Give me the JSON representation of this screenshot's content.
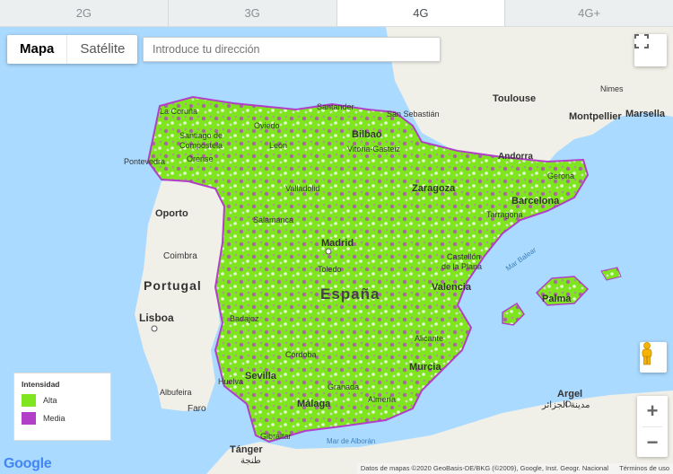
{
  "tabs": [
    {
      "label": "2G"
    },
    {
      "label": "3G"
    },
    {
      "label": "4G"
    },
    {
      "label": "4G+"
    }
  ],
  "active_tab": "4G",
  "map_type": {
    "map_label": "Mapa",
    "satellite_label": "Satélite",
    "selected": "Mapa"
  },
  "search": {
    "placeholder": "Introduce tu dirección",
    "value": ""
  },
  "legend": {
    "title": "Intensidad",
    "items": [
      {
        "label": "Alta",
        "color": "#7fe51f"
      },
      {
        "label": "Media",
        "color": "#b23fc8"
      }
    ]
  },
  "colors": {
    "sea": "#aadaff",
    "land": "#f1f0e8",
    "coverage_high": "#7fe51f",
    "coverage_medium": "#b23fc8"
  },
  "places": {
    "spain": "España",
    "portugal": "Portugal",
    "lisboa": "Lisboa",
    "oporto": "Oporto",
    "coimbra": "Coimbra",
    "faro": "Faro",
    "albufeira": "Albufeira",
    "madrid": "Madrid",
    "toledo": "Toledo",
    "valencia": "Valencia",
    "barcelona": "Barcelona",
    "tarragona": "Tarragona",
    "zaragoza": "Zaragoza",
    "bilbao": "Bilbao",
    "santander": "Santander",
    "san_sebastian": "San Sebastián",
    "vitoria": "Vitoria-Gasteiz",
    "oviedo": "Oviedo",
    "la_coruna": "La Coruña",
    "santiago": "Santiago de Compostela",
    "pontevedra": "Pontevedra",
    "orense": "Orense",
    "leon": "León",
    "valladolid": "Valladolid",
    "salamanca": "Salamanca",
    "badajoz": "Badajoz",
    "cordoba": "Córdoba",
    "sevilla": "Sevilla",
    "huelva": "Huelva",
    "granada": "Granada",
    "malaga": "Málaga",
    "almeria": "Almería",
    "murcia": "Murcia",
    "alicante": "Alicante",
    "castellon": "Castellón de la Plana",
    "palma": "Palma",
    "gibraltar": "Gibraltar",
    "tanger": "Tánger",
    "tanger_ar": "طنجة",
    "argel": "Argel",
    "argel_ar": "مدينة الجزائر",
    "andorra": "Andorra",
    "girona": "Gerona",
    "toulouse": "Toulouse",
    "nimes": "Nimes",
    "montpellier": "Montpellier",
    "marsella": "Marsella",
    "mar_balear": "Mar Balear",
    "mar_alboran": "Mar de Alborán"
  },
  "branding": {
    "logo": "Google"
  },
  "attribution": {
    "data": "Datos de mapas ©2020 GeoBasis-DE/BKG (©2009), Google, Inst. Geogr. Nacional",
    "terms": "Términos de uso"
  },
  "controls": {
    "zoom_in": "+",
    "zoom_out": "−"
  }
}
